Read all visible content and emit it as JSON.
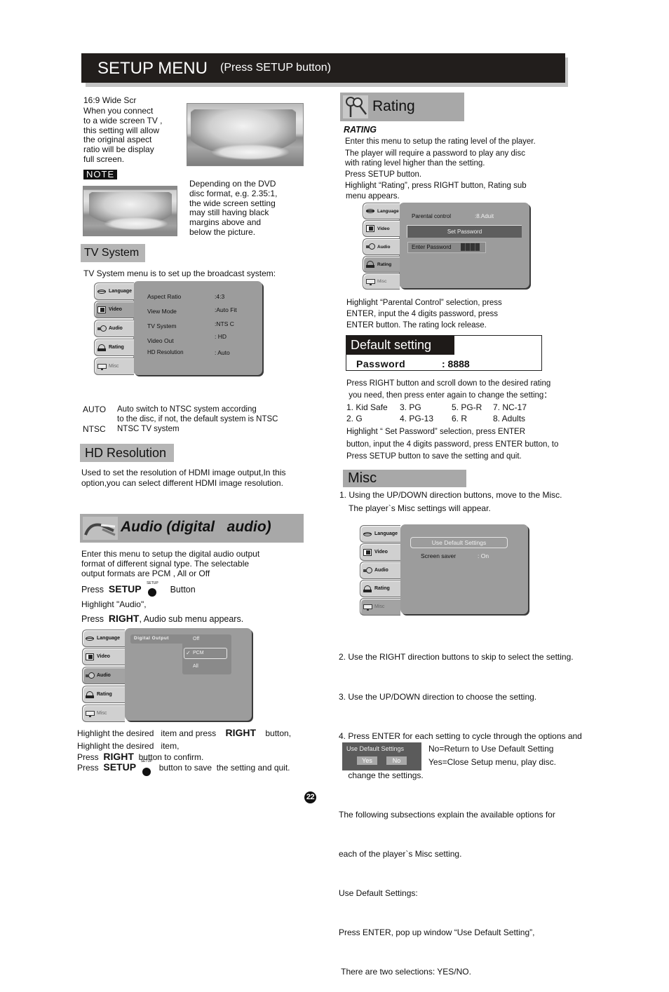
{
  "header": {
    "title": "SETUP MENU",
    "subtitle": "(Press SETUP button)"
  },
  "wide_screen": {
    "title": "16:9 Wide Scr",
    "lines": [
      "When you connect",
      "to a wide  screen TV ,",
      "this setting will allow",
      "the original aspect",
      "ratio will be display",
      "full screen."
    ],
    "note_label": "NOTE",
    "note_lines": [
      "Depending on the  DVD",
      "disc format, e.g.  2.35:1,",
      "the wide screen setting",
      "may still having  black",
      "margins above and",
      "below the picture."
    ],
    "image_1_alt": "iceberg-photo-widescreen",
    "image_2_alt": "iceberg-photo-letterbox"
  },
  "osd_tabs": [
    "Language",
    "Video",
    "Audio",
    "Rating",
    "Misc"
  ],
  "tv_system": {
    "heading": "TV System",
    "intro": "TV System menu  is to set up the broadcast  system:",
    "menu_rows": [
      {
        "label": "Aspect Ratio",
        "value": ":4:3"
      },
      {
        "label": "View Mode",
        "value": ":Auto Fit"
      },
      {
        "label": "TV System",
        "value": ":NTS C"
      },
      {
        "label": "Video Out",
        "value": ": HD"
      },
      {
        "label": "HD Resolution",
        "value": ": Auto"
      }
    ],
    "options": [
      {
        "key": "AUTO",
        "desc_1": "Auto switch to  NTSC system according",
        "desc_2": "to the disc, if not, the default system is NTSC"
      },
      {
        "key": "NTSC",
        "desc_1": "NTSC TV system"
      }
    ]
  },
  "hd_resolution": {
    "heading": "HD Resolution",
    "lines": [
      "Used to set the resolution of HDMI image output,In this",
      "option,you can select different HDMI image resolution."
    ]
  },
  "audio": {
    "heading": "Audio (digital   audio)",
    "lines": [
      "Enter this menu   to setup the  digital audio output",
      "format of different signal type.  The selectable",
      "output formats are  PCM , All  or Off"
    ],
    "press": "Press",
    "setup": "SETUP",
    "button": "Button",
    "setup_cap": "SETUP",
    "highlight": "Highlight \"Audio\",",
    "right": "RIGHT",
    "right_suffix": ", Audio sub menu appears.",
    "menu": {
      "item_label": "Digital Output",
      "options": [
        "Off",
        "PCM",
        "All"
      ],
      "selected": "PCM",
      "check": "✓"
    },
    "after": {
      "l1_a": "Highlight the desired   item and press",
      "l1_b": "RIGHT",
      "l1_c": "button,",
      "l2": "Highlight the desired   item,",
      "l3_a": "Press",
      "l3_b": "RIGHT",
      "l3_c": "button to confirm.",
      "l4_a": "Press",
      "l4_b": "SETUP",
      "l4_c": "button to save  the setting and quit."
    }
  },
  "rating": {
    "heading": "Rating",
    "subheading": "RATING",
    "lines": [
      "Enter this menu to setup the rating level of the player.",
      "The player will require a  password to play any disc",
      "with rating level higher than the setting.",
      "Press SETUP button.",
      "Highlight “Rating”, press RIGHT  button, Rating sub",
      "menu appears."
    ],
    "menu": {
      "parental_label": "Parental control",
      "parental_value": ":8.Aduit",
      "set_password": "Set Password",
      "enter_password": "Enter Password",
      "password_mask": "████"
    },
    "after_lines": [
      "Highlight “Parental Control” selection, press",
      "ENTER, input the 4 digits password, press",
      "ENTER button.  The rating lock release."
    ],
    "default_box": {
      "title": "Default setting",
      "password_label": "Password",
      "password_value": ": 8888"
    },
    "scroll_lines": [
      "Press RIGHT button and scroll down to the desired rating",
      " you need, then press enter again to change the setting："
    ],
    "levels": [
      "1. Kid Safe",
      "3. PG",
      "5. PG-R",
      "7. NC-17",
      "2. G",
      "4. PG-13",
      "6. R",
      "8. Adults"
    ],
    "final_lines": [
      "Highlight “ Set Password” selection, press ENTER",
      "button, input the 4 digits password, press ENTER button, to",
      "Press SETUP button to save the setting and quit."
    ]
  },
  "misc": {
    "heading": "Misc",
    "step1_a": "1. Using the UP/DOWN direction buttons, move to the Misc.",
    "step1_b": "The player`s Misc settings will appear.",
    "menu": {
      "use_default": "Use Default Settings",
      "screen_saver_label": "Screen saver",
      "screen_saver_value": ": On"
    },
    "lines": [
      "2. Use the RIGHT direction buttons to skip to select the setting.",
      "3. Use the UP/DOWN direction to choose the setting.",
      "4. Press ENTER for each setting to cycle through the options and",
      "    change the settings.",
      "The following subsections explain the available options for",
      "each of the player`s Misc setting.",
      "Use Default Settings:",
      "Press ENTER, pop up window “Use Default Setting”,",
      " There are two selections: YES/NO."
    ],
    "popup": {
      "title": "Use Default Settings",
      "yes": "Yes",
      "no": "No"
    },
    "popup_notes": [
      "No=Return to Use Default Setting",
      "Yes=Close Setup menu, play disc."
    ]
  },
  "page_number": "22"
}
